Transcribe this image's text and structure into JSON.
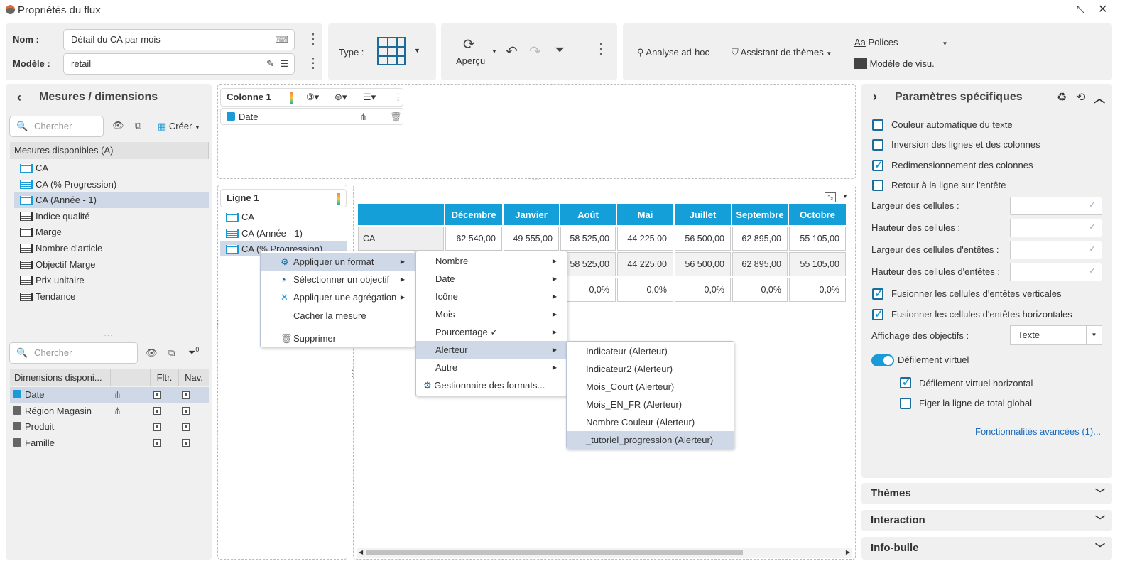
{
  "window": {
    "title": "Propriétés du flux"
  },
  "toolbar": {
    "name_label": "Nom :",
    "name_value": "Détail du CA par mois",
    "model_label": "Modèle :",
    "model_value": "retail",
    "type_label": "Type :",
    "preview_label": "Aperçu",
    "adhoc_label": "Analyse ad-hoc",
    "theme_assistant_label": "Assistant de thèmes",
    "fonts_label": "Polices",
    "visu_model_label": "Modèle de visu."
  },
  "left": {
    "title": "Mesures / dimensions",
    "search_placeholder": "Chercher",
    "create_label": "Créer",
    "measures_header": "Mesures disponibles (A)",
    "measures": [
      "CA",
      "CA (% Progression)",
      "CA (Année - 1)",
      "Indice qualité",
      "Marge",
      "Nombre d'article",
      "Objectif Marge",
      "Prix unitaire",
      "Tendance"
    ],
    "search2_placeholder": "Chercher",
    "filter_count": "0",
    "dim_headers": [
      "Dimensions disponi...",
      "",
      "Fltr.",
      "Nav."
    ],
    "dimensions": [
      "Date",
      "Région Magasin",
      "Produit",
      "Famille"
    ]
  },
  "center": {
    "column_title": "Colonne 1",
    "column_item": "Date",
    "row_title": "Ligne 1",
    "row_items": [
      "CA",
      "CA (Année - 1)",
      "CA (% Progression)"
    ],
    "table": {
      "columns": [
        "Décembre",
        "Janvier",
        "Août",
        "Mai",
        "Juillet",
        "Septembre",
        "Octobre"
      ],
      "rows": [
        {
          "label": "CA",
          "values": [
            "62 540,00",
            "49 555,00",
            "58 525,00",
            "44 225,00",
            "56 500,00",
            "62 895,00",
            "55 105,00"
          ]
        },
        {
          "label": "",
          "values": [
            "",
            "",
            "58 525,00",
            "44 225,00",
            "56 500,00",
            "62 895,00",
            "55 105,00"
          ]
        },
        {
          "label": "",
          "values": [
            "",
            "",
            "0,0%",
            "0,0%",
            "0,0%",
            "0,0%",
            "0,0%"
          ]
        }
      ]
    }
  },
  "menu1": [
    "Appliquer un format",
    "Sélectionner un objectif",
    "Appliquer une agrégation",
    "Cacher la mesure",
    "Supprimer"
  ],
  "menu2": [
    "Nombre",
    "Date",
    "Icône",
    "Mois",
    "Pourcentage ✓",
    "Alerteur",
    "Autre",
    "Gestionnaire des formats..."
  ],
  "menu3": [
    "Indicateur (Alerteur)",
    "Indicateur2 (Alerteur)",
    "Mois_Court (Alerteur)",
    "Mois_EN_FR (Alerteur)",
    "Nombre Couleur (Alerteur)",
    "_tutoriel_progression (Alerteur)"
  ],
  "right": {
    "title": "Paramètres spécifiques",
    "checks": [
      {
        "label": "Couleur automatique du texte",
        "checked": false
      },
      {
        "label": "Inversion des lignes et des colonnes",
        "checked": false
      },
      {
        "label": "Redimensionnement des colonnes",
        "checked": true
      },
      {
        "label": "Retour à la ligne sur l'entête",
        "checked": false
      }
    ],
    "fields": [
      "Largeur des cellules :",
      "Hauteur des cellules :",
      "Largeur des cellules d'entêtes :",
      "Hauteur des cellules d'entêtes :"
    ],
    "checks2": [
      {
        "label": "Fusionner les cellules d'entêtes verticales",
        "checked": true
      },
      {
        "label": "Fusionner les cellules d'entêtes horizontales",
        "checked": true
      }
    ],
    "objectives_label": "Affichage des objectifs :",
    "objectives_value": "Texte",
    "virtual_label": "Défilement virtuel",
    "virtual_on": true,
    "virtual_h_label": "Défilement virtuel horizontal",
    "virtual_h_checked": true,
    "freeze_label": "Figer la ligne de total global",
    "freeze_checked": false,
    "advanced_link": "Fonctionnalités avancées (1)..."
  },
  "accordions": [
    "Thèmes",
    "Interaction",
    "Info-bulle"
  ],
  "colors": {
    "accent": "#149fd9",
    "highlight": "#cfd8e6",
    "panel": "#f0f0f0"
  }
}
